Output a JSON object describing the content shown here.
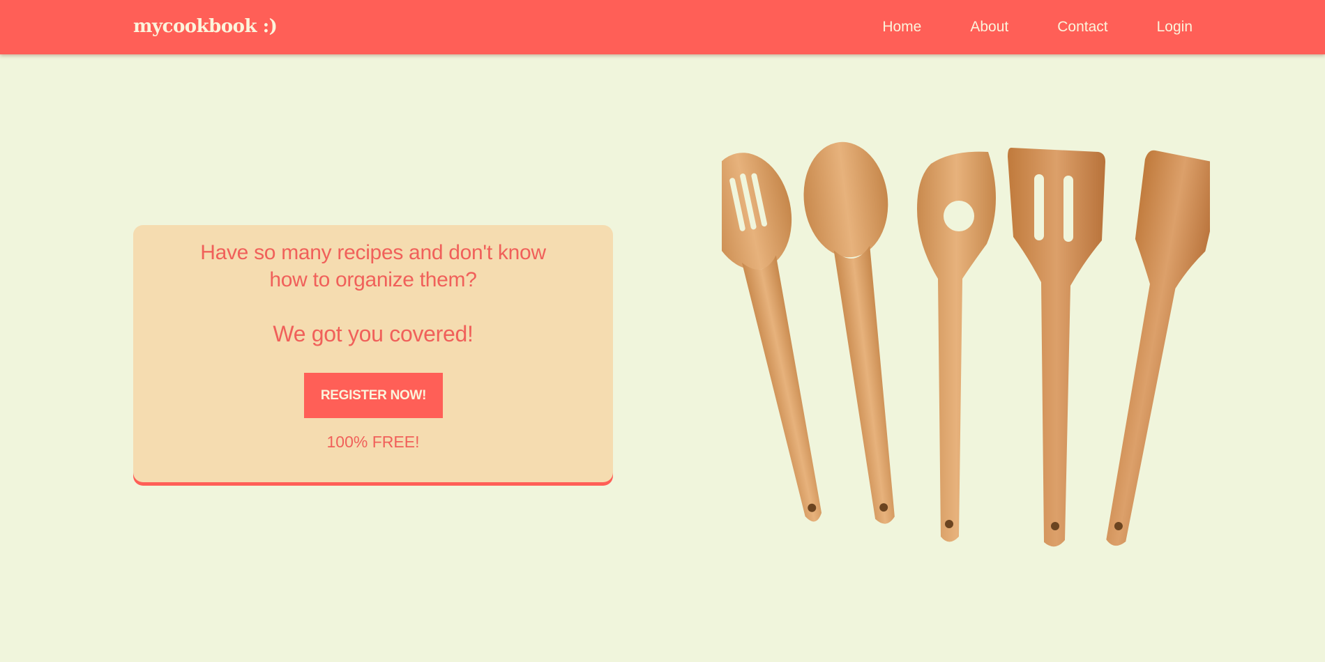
{
  "navbar": {
    "logo": "mycookbook :)",
    "links": [
      "Home",
      "About",
      "Contact",
      "Login"
    ]
  },
  "hero": {
    "question_line1": "Have so many recipes and don't know",
    "question_line2": "how to organize them?",
    "tagline": "We got you covered!",
    "register_label": "REGISTER NOW!",
    "free_note": "100% FREE!"
  },
  "colors": {
    "background": "#f0f5dc",
    "accent": "#ff5f57",
    "card": "#f5dcb0",
    "text_light": "#fbf4dc"
  },
  "image": {
    "icon": "wooden-utensils-icon"
  }
}
